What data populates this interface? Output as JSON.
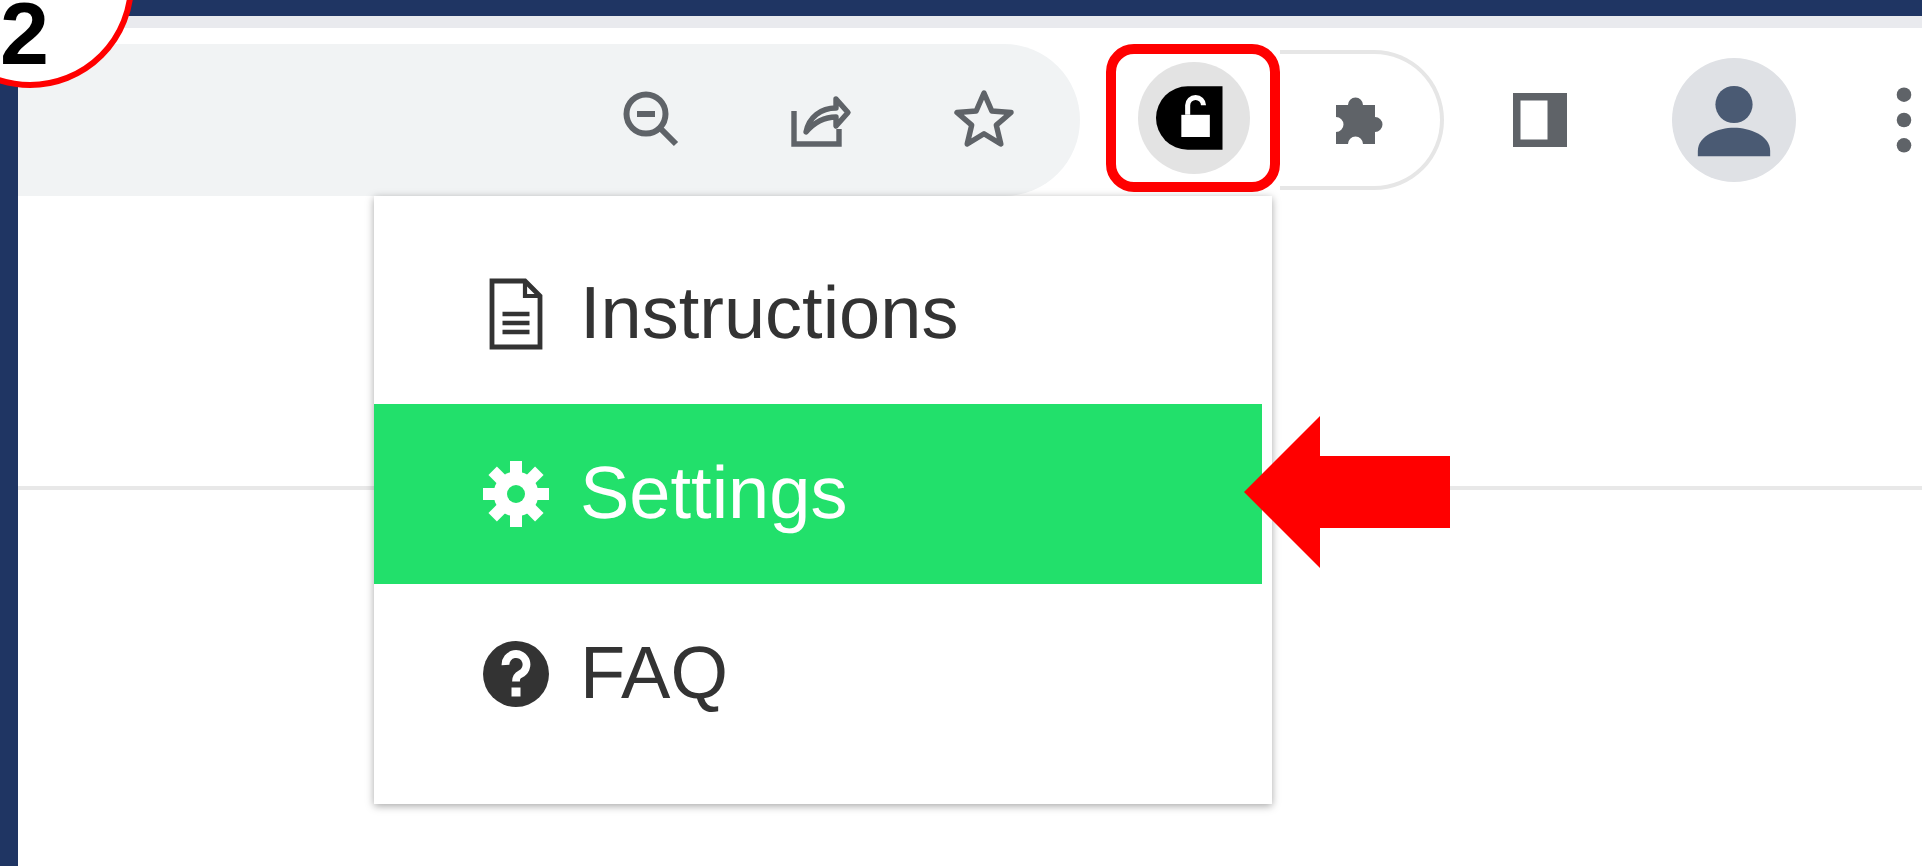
{
  "step_badge": "2",
  "menu": {
    "items": [
      {
        "label": "Instructions",
        "kind": "document",
        "selected": false
      },
      {
        "label": "Settings",
        "kind": "gear",
        "selected": true
      },
      {
        "label": "FAQ",
        "kind": "help",
        "selected": false
      }
    ]
  }
}
